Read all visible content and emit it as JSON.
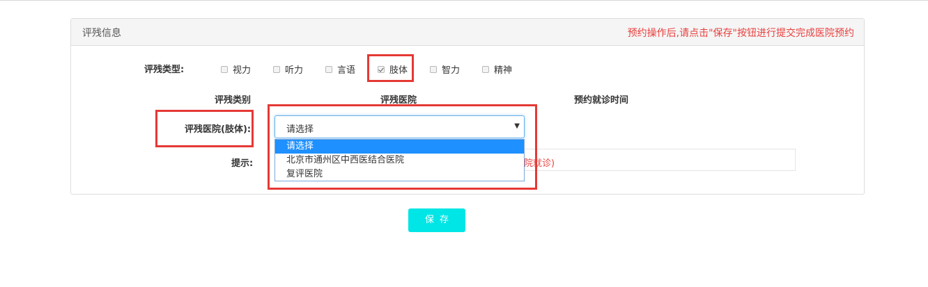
{
  "panel": {
    "title": "评残信息",
    "note": "预约操作后,请点击\"保存\"按钮进行提交完成医院预约"
  },
  "type_label": "评残类型:",
  "types": [
    {
      "label": "视力",
      "checked": false
    },
    {
      "label": "听力",
      "checked": false
    },
    {
      "label": "言语",
      "checked": false
    },
    {
      "label": "肢体",
      "checked": true
    },
    {
      "label": "智力",
      "checked": false
    },
    {
      "label": "精神",
      "checked": false
    }
  ],
  "columns": [
    "评残类别",
    "评残医院",
    "预约就诊时间"
  ],
  "hospital_label": "评残医院(肢体):",
  "select": {
    "value": "请选择",
    "options": [
      "请选择",
      "北京市通州区中西医结合医院",
      "复评医院"
    ]
  },
  "hint_label": "提示:",
  "hint_text": "院就诊)",
  "save_label": "保存"
}
